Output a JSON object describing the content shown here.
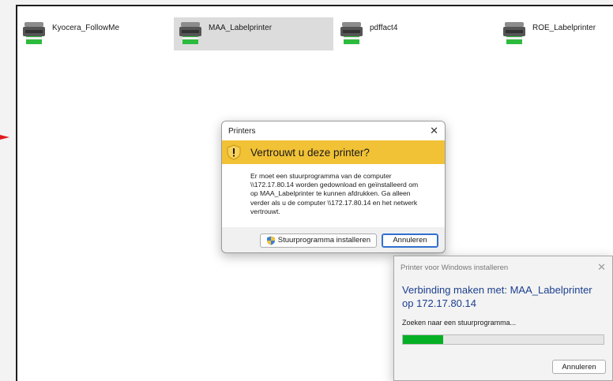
{
  "printers": [
    {
      "name": "Kyocera_FollowMe",
      "selected": false
    },
    {
      "name": "MAA_Labelprinter",
      "selected": true
    },
    {
      "name": "pdffact4",
      "selected": false
    },
    {
      "name": "ROE_Labelprinter",
      "selected": false
    }
  ],
  "trust_dialog": {
    "title": "Printers",
    "close_glyph": "✕",
    "warning_icon": "warning-shield-icon",
    "heading": "Vertrouwt u deze printer?",
    "message_lines": [
      "Er moet een stuurprogramma van de computer",
      "\\\\172.17.80.14 worden gedownload en geïnstalleerd om",
      "op MAA_Labelprinter te kunnen afdrukken. Ga alleen",
      "verder als u de computer \\\\172.17.80.14 en het netwerk",
      "vertrouwt."
    ],
    "install_button": "Stuurprogramma installeren",
    "cancel_button": "Annuleren"
  },
  "install_dialog": {
    "title": "Printer voor Windows installeren",
    "close_glyph": "✕",
    "heading": "Verbinding maken met: MAA_Labelprinter op 172.17.80.14",
    "status": "Zoeken naar een stuurprogramma...",
    "progress": 0.2,
    "cancel_button": "Annuleren"
  },
  "colors": {
    "warning_band": "#f2c236",
    "progress_fill": "#06b025",
    "heading_blue": "#1c3f8f",
    "arrow": "#e01b1b"
  }
}
